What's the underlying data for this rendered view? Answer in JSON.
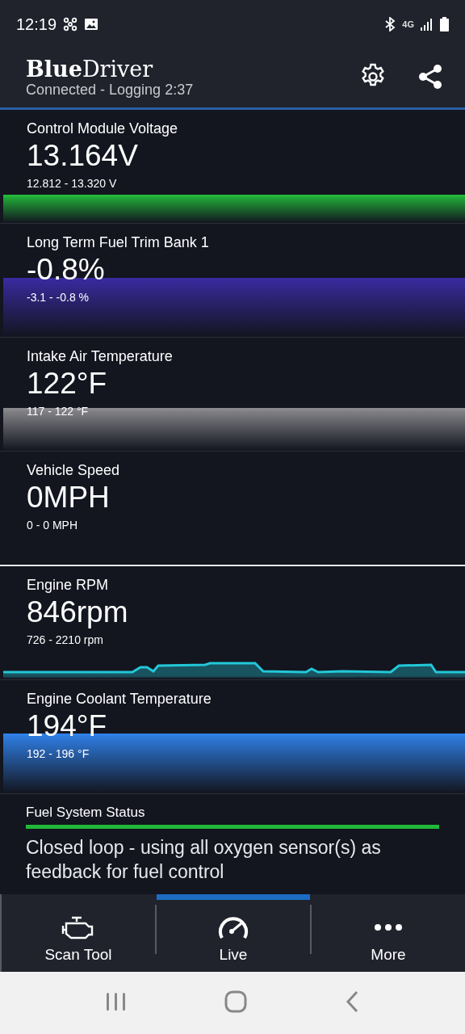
{
  "status_bar": {
    "time": "12:19",
    "network": "4G"
  },
  "header": {
    "logo_bold": "Blue",
    "logo_light": "Driver",
    "subtitle": "Connected - Logging 2:37"
  },
  "gauges": [
    {
      "name": "Control Module Voltage",
      "value": "13.164V",
      "range": "12.812 - 13.320 V",
      "kind": "area",
      "color": "#22b83a",
      "selected": false
    },
    {
      "name": "Long Term Fuel Trim Bank 1",
      "value": "-0.8%",
      "range": "-3.1 - -0.8 %",
      "kind": "area",
      "color": "#3a2aa0",
      "selected": false
    },
    {
      "name": "Intake Air Temperature",
      "value": "122°F",
      "range": "117 - 122 °F",
      "kind": "area",
      "color": "#8a8a8e",
      "selected": false
    },
    {
      "name": "Vehicle Speed",
      "value": "0MPH",
      "range": "0 - 0 MPH",
      "kind": "none",
      "selected": true
    },
    {
      "name": "Engine RPM",
      "value": "846rpm",
      "range": "726 - 2210 rpm",
      "kind": "line",
      "color": "#22c8d8",
      "selected": false
    },
    {
      "name": "Engine Coolant Temperature",
      "value": "194°F",
      "range": "192 - 196 °F",
      "kind": "area",
      "color": "#2f80e8",
      "selected": false
    }
  ],
  "status_card": {
    "title": "Fuel System Status",
    "text": "Closed loop - using all oxygen sensor(s) as feedback for fuel control"
  },
  "nav": [
    {
      "label": "Scan Tool",
      "selected": false
    },
    {
      "label": "Live",
      "selected": true
    },
    {
      "label": "More",
      "selected": false
    }
  ]
}
